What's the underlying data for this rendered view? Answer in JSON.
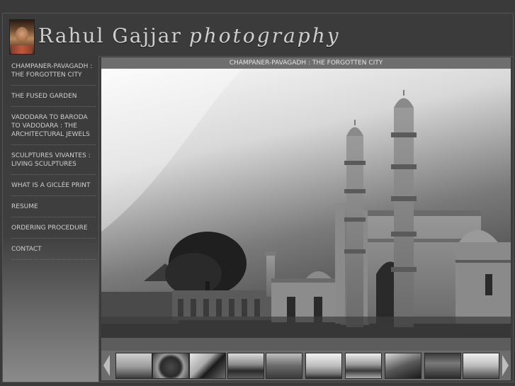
{
  "header": {
    "brand_name": "Rahul Gajjar",
    "brand_tag": "photography"
  },
  "sidebar": {
    "items": [
      {
        "label": "CHAMPANER-PAVAGADH : THE FORGOTTEN CITY"
      },
      {
        "label": "THE FUSED GARDEN"
      },
      {
        "label": "VADODARA TO BARODA TO VADODARA : THE ARCHITECTURAL JEWELS"
      },
      {
        "label": "SCULPTURES VIVANTES : LIVING SCULPTURES"
      },
      {
        "label": "WHAT IS A GICLÉE PRINT"
      },
      {
        "label": "RESUME"
      },
      {
        "label": "ORDERING PROCEDURE"
      },
      {
        "label": "CONTACT"
      }
    ]
  },
  "gallery": {
    "title": "CHAMPANER-PAVAGADH : THE FORGOTTEN CITY",
    "prev_icon": "triangle-left-icon",
    "next_icon": "triangle-right-icon",
    "thumbnail_count": 10
  }
}
